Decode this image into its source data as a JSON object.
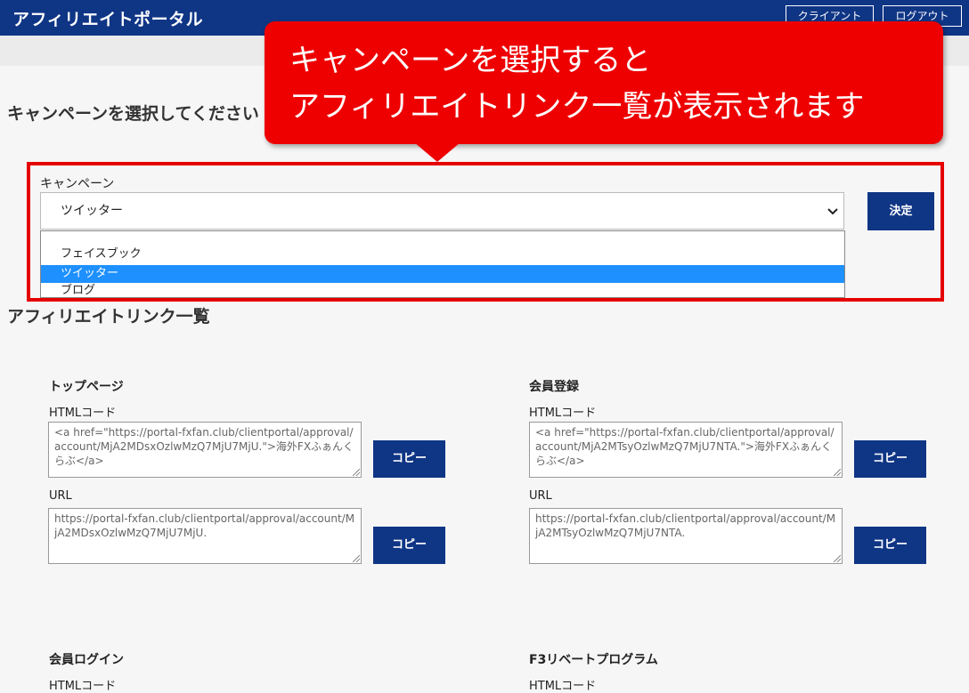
{
  "header": {
    "brand": "アフィリエイトポータル",
    "client_label": "クライアント",
    "logout_label": "ログアウト"
  },
  "callout": {
    "line1": "キャンペーンを選択すると",
    "line2": "アフィリエイトリンク一覧が表示されます"
  },
  "campaign": {
    "heading": "キャンペーンを選択してください",
    "label": "キャンペーン",
    "selected_value": "ツイッター",
    "decide_label": "決定",
    "options": [
      "フェイスブック",
      "ツイッター",
      "ブログ"
    ]
  },
  "links": {
    "heading": "アフィリエイトリンク一覧",
    "sections": [
      {
        "title": "トップページ",
        "html_label": "HTMLコード",
        "html_code": "<a href=\"https://portal-fxfan.club/clientportal/approval/account/MjA2MDsxOzlwMzQ7MjU7MjU.\">海外FXふぁんくらぶ</a>",
        "url_label": "URL",
        "url": "https://portal-fxfan.club/clientportal/approval/account/MjA2MDsxOzlwMzQ7MjU7MjU.",
        "copy_label": "コピー"
      },
      {
        "title": "会員登録",
        "html_label": "HTMLコード",
        "html_code": "<a href=\"https://portal-fxfan.club/clientportal/approval/account/MjA2MTsyOzlwMzQ7MjU7NTA.\">海外FXふぁんくらぶ</a>",
        "url_label": "URL",
        "url": "https://portal-fxfan.club/clientportal/approval/account/MjA2MTsyOzlwMzQ7MjU7NTA.",
        "copy_label": "コピー"
      },
      {
        "title": "会員ログイン",
        "html_label": "HTMLコード"
      },
      {
        "title": "F3リベートプログラム",
        "html_label": "HTMLコード"
      }
    ]
  },
  "colors": {
    "brand_navy": "#0f3585",
    "callout_red": "#ee0000",
    "selection_blue": "#1e90ff"
  },
  "icons": {
    "select_arrow": "chevron-down-icon"
  }
}
